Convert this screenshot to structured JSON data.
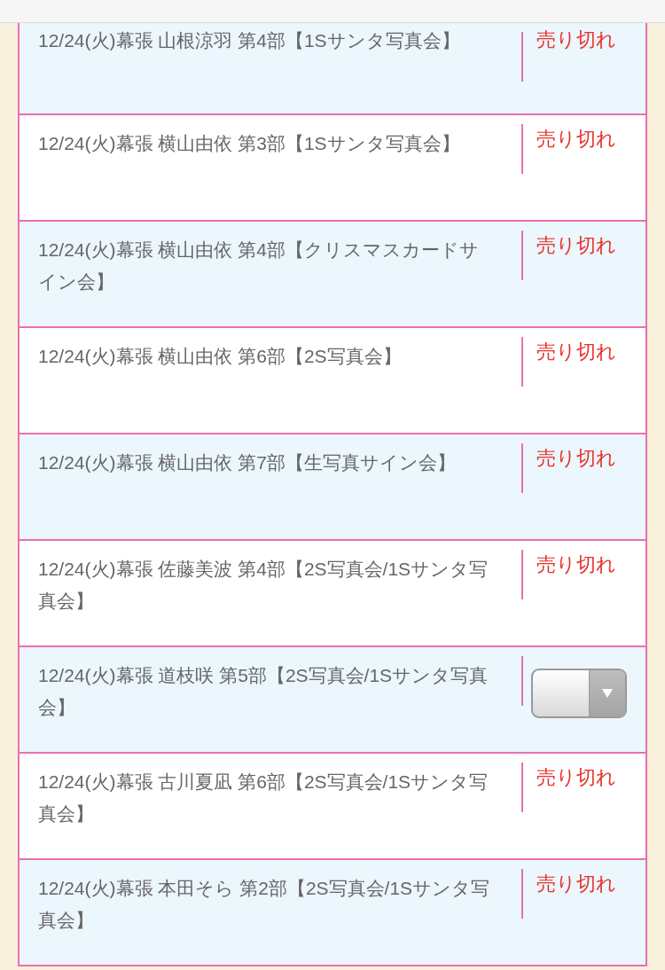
{
  "rows": [
    {
      "title": "12/24(火)幕張 山根涼羽 第4部【1Sサンタ写真会】",
      "kind": "soldout",
      "status": "売り切れ"
    },
    {
      "title": "12/24(火)幕張 横山由依 第3部【1Sサンタ写真会】",
      "kind": "soldout",
      "status": "売り切れ"
    },
    {
      "title": "12/24(火)幕張 横山由依 第4部【クリスマスカードサイン会】",
      "kind": "soldout",
      "status": "売り切れ"
    },
    {
      "title": "12/24(火)幕張 横山由依 第6部【2S写真会】",
      "kind": "soldout",
      "status": "売り切れ"
    },
    {
      "title": "12/24(火)幕張 横山由依 第7部【生写真サイン会】",
      "kind": "soldout",
      "status": "売り切れ"
    },
    {
      "title": "12/24(火)幕張 佐藤美波 第4部【2S写真会/1Sサンタ写真会】",
      "kind": "soldout",
      "status": "売り切れ"
    },
    {
      "title": "12/24(火)幕張 道枝咲 第5部【2S写真会/1Sサンタ写真会】",
      "kind": "select"
    },
    {
      "title": "12/24(火)幕張 古川夏凪 第6部【2S写真会/1Sサンタ写真会】",
      "kind": "soldout",
      "status": "売り切れ"
    },
    {
      "title": "12/24(火)幕張 本田そら 第2部【2S写真会/1Sサンタ写真会】",
      "kind": "soldout",
      "status": "売り切れ"
    }
  ]
}
